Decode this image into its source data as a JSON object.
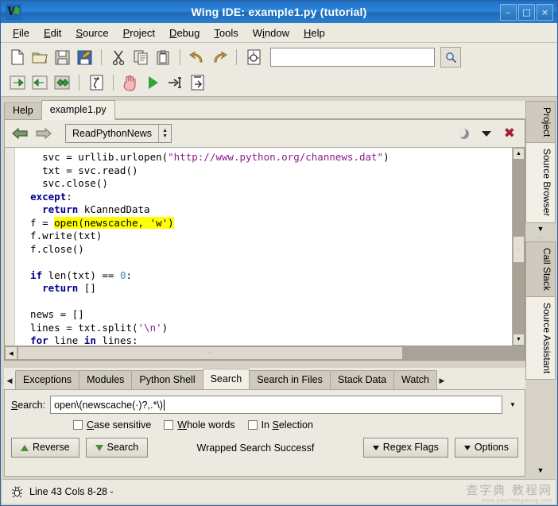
{
  "window": {
    "title": "Wing IDE: example1.py (tutorial)",
    "app_icon": "wing-logo-icon",
    "buttons": [
      {
        "name": "minimize-button",
        "glyph": "–"
      },
      {
        "name": "maximize-button",
        "glyph": "□"
      },
      {
        "name": "close-button",
        "glyph": "×"
      }
    ]
  },
  "menubar": {
    "items": [
      {
        "label": "File",
        "accel": "F"
      },
      {
        "label": "Edit",
        "accel": "E"
      },
      {
        "label": "Source",
        "accel": "S"
      },
      {
        "label": "Project",
        "accel": "P"
      },
      {
        "label": "Debug",
        "accel": "D"
      },
      {
        "label": "Tools",
        "accel": "T"
      },
      {
        "label": "Window",
        "accel": "W"
      },
      {
        "label": "Help",
        "accel": "H"
      }
    ]
  },
  "toolbar": {
    "row1": [
      {
        "name": "new-file-icon",
        "title": "New"
      },
      {
        "name": "open-folder-icon",
        "title": "Open"
      },
      {
        "name": "save-icon",
        "title": "Save"
      },
      {
        "name": "save-as-icon",
        "title": "Save As"
      },
      {
        "name": "cut-icon",
        "title": "Cut"
      },
      {
        "name": "copy-icon",
        "title": "Copy"
      },
      {
        "name": "paste-icon",
        "title": "Paste"
      },
      {
        "name": "undo-icon",
        "title": "Undo"
      },
      {
        "name": "redo-icon",
        "title": "Redo"
      },
      {
        "name": "debug-file-icon",
        "title": "Debug File"
      }
    ],
    "search_entry_value": "",
    "search_entry_placeholder": "",
    "find_button": "find-icon",
    "row2": [
      {
        "name": "step-forward-icon",
        "title": "Forward"
      },
      {
        "name": "step-back-icon",
        "title": "Back"
      },
      {
        "name": "step-over-icon",
        "title": "Step Over"
      },
      {
        "name": "debug-probe-icon",
        "title": "Debug Probe"
      },
      {
        "name": "stop-hand-icon",
        "title": "Stop"
      },
      {
        "name": "run-icon",
        "title": "Run"
      },
      {
        "name": "step-into-icon",
        "title": "Step Into"
      },
      {
        "name": "step-out-icon",
        "title": "Step Out"
      }
    ]
  },
  "editor": {
    "tabs": [
      {
        "label": "Help",
        "active": false
      },
      {
        "label": "example1.py",
        "active": true
      }
    ],
    "nav": {
      "back_icon": "arrow-left-icon",
      "forward_icon": "arrow-right-icon",
      "symbol_selector": "ReadPythonNews"
    },
    "header_right": [
      {
        "name": "moon-icon"
      },
      {
        "name": "chevron-down-icon"
      },
      {
        "name": "close-editor-icon"
      }
    ],
    "code_lines": [
      [
        {
          "t": "    svc = urllib.urlopen(",
          "c": ""
        },
        {
          "t": "\"http://www.python.org/channews.dat\"",
          "c": "s"
        },
        {
          "t": ")",
          "c": ""
        }
      ],
      [
        {
          "t": "    txt = svc.read()",
          "c": ""
        }
      ],
      [
        {
          "t": "    svc.close()",
          "c": ""
        }
      ],
      [
        {
          "t": "  ",
          "c": ""
        },
        {
          "t": "except",
          "c": "k"
        },
        {
          "t": ":",
          "c": ""
        }
      ],
      [
        {
          "t": "    ",
          "c": ""
        },
        {
          "t": "return",
          "c": "k"
        },
        {
          "t": " kCannedData",
          "c": ""
        }
      ],
      [
        {
          "t": "  f = ",
          "c": ""
        },
        {
          "t": "open(newscache, 'w')",
          "c": "hl"
        }
      ],
      [
        {
          "t": "  f.write(txt)",
          "c": ""
        }
      ],
      [
        {
          "t": "  f.close()",
          "c": ""
        }
      ],
      [
        {
          "t": "",
          "c": ""
        }
      ],
      [
        {
          "t": "  ",
          "c": ""
        },
        {
          "t": "if",
          "c": "k"
        },
        {
          "t": " len(txt) == ",
          "c": ""
        },
        {
          "t": "0",
          "c": "n"
        },
        {
          "t": ":",
          "c": ""
        }
      ],
      [
        {
          "t": "    ",
          "c": ""
        },
        {
          "t": "return",
          "c": "k"
        },
        {
          "t": " []",
          "c": ""
        }
      ],
      [
        {
          "t": "",
          "c": ""
        }
      ],
      [
        {
          "t": "  news = []",
          "c": ""
        }
      ],
      [
        {
          "t": "  lines = txt.split(",
          "c": ""
        },
        {
          "t": "'\\n'",
          "c": "s"
        },
        {
          "t": ")",
          "c": ""
        }
      ],
      [
        {
          "t": "  ",
          "c": ""
        },
        {
          "t": "for",
          "c": "k"
        },
        {
          "t": " line ",
          "c": ""
        },
        {
          "t": "in",
          "c": "k"
        },
        {
          "t": " lines:",
          "c": ""
        }
      ]
    ]
  },
  "bottom_panel": {
    "scroll_left_icon": "triangle-left-icon",
    "scroll_right_icon": "triangle-right-icon",
    "tabs": [
      {
        "label": "Exceptions",
        "active": false
      },
      {
        "label": "Modules",
        "active": false
      },
      {
        "label": "Python Shell",
        "active": false
      },
      {
        "label": "Search",
        "active": true
      },
      {
        "label": "Search in Files",
        "active": false
      },
      {
        "label": "Stack Data",
        "active": false
      },
      {
        "label": "Watch",
        "active": false
      }
    ],
    "search": {
      "label": "Search:",
      "value": "open\\(newscache(·)?,.*\\)",
      "placeholder": "",
      "dropdown_icon": "chevron-down-icon"
    },
    "checkboxes": [
      {
        "label": "Case sensitive",
        "accel": "C",
        "checked": false
      },
      {
        "label": "Whole words",
        "accel": "W",
        "checked": false
      },
      {
        "label": "In Selection",
        "accel": "S",
        "checked": false
      }
    ],
    "buttons": {
      "reverse": "Reverse",
      "search": "Search",
      "regex_flags": "Regex Flags",
      "options": "Options"
    },
    "status_message": "Wrapped Search Successf"
  },
  "right_dock": {
    "tabs": [
      {
        "label": "Project",
        "active": true
      },
      {
        "label": "Source Browser",
        "active": false
      },
      {
        "label": "Call Stack",
        "active": true
      },
      {
        "label": "Source Assistant",
        "active": false
      }
    ],
    "collapse_icon": "triangle-down-icon"
  },
  "statusbar": {
    "icon": "bug-icon",
    "text": "Line 43 Cols 8-28 -"
  },
  "watermark": {
    "main": "查字典 教程网",
    "sub": "www.jiaochengwang.com"
  }
}
